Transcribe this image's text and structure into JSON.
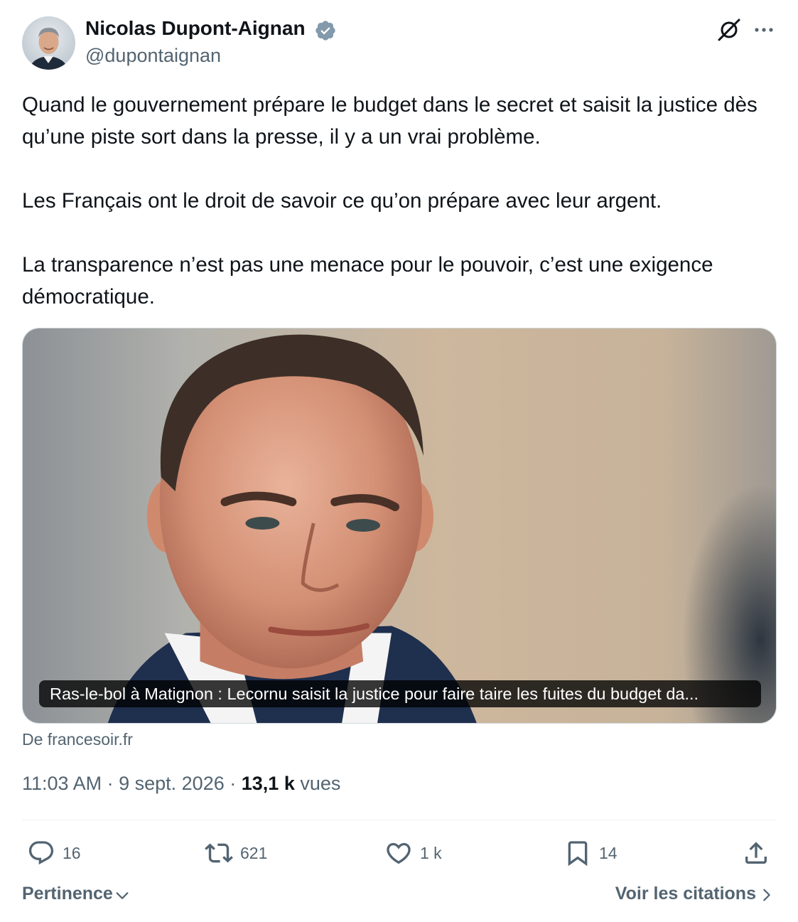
{
  "author": {
    "name": "Nicolas Dupont-Aignan",
    "handle": "@dupontaignan",
    "verified": true
  },
  "header_icons": [
    "grok-icon",
    "more-icon"
  ],
  "tweet": {
    "paragraphs": [
      "Quand le gouvernement prépare le budget dans le secret et saisit la justice dès qu’une piste sort dans la presse, il y a un vrai problème.",
      "Les Français ont le droit de savoir ce qu’on prépare avec leur argent.",
      "La transparence n’est pas une menace pour le pouvoir, c’est une exigence démocratique."
    ]
  },
  "card": {
    "caption": "Ras-le-bol à Matignon : Lecornu saisit la justice pour faire taire les fuites du budget da...",
    "source": "De francesoir.fr"
  },
  "meta": {
    "time": "11:03 AM",
    "separator": "·",
    "date": "9 sept. 2026",
    "views_count": "13,1 k",
    "views_label": "vues"
  },
  "actions": {
    "replies": "16",
    "reposts": "621",
    "likes": "1 k",
    "bookmarks": "14"
  },
  "footer": {
    "sort_label": "Pertinence",
    "quotes_label": "Voir les citations"
  },
  "colors": {
    "text_primary": "#0f1419",
    "text_secondary": "#536471",
    "verified_badge": "#829aab",
    "border": "#cfd9de"
  }
}
